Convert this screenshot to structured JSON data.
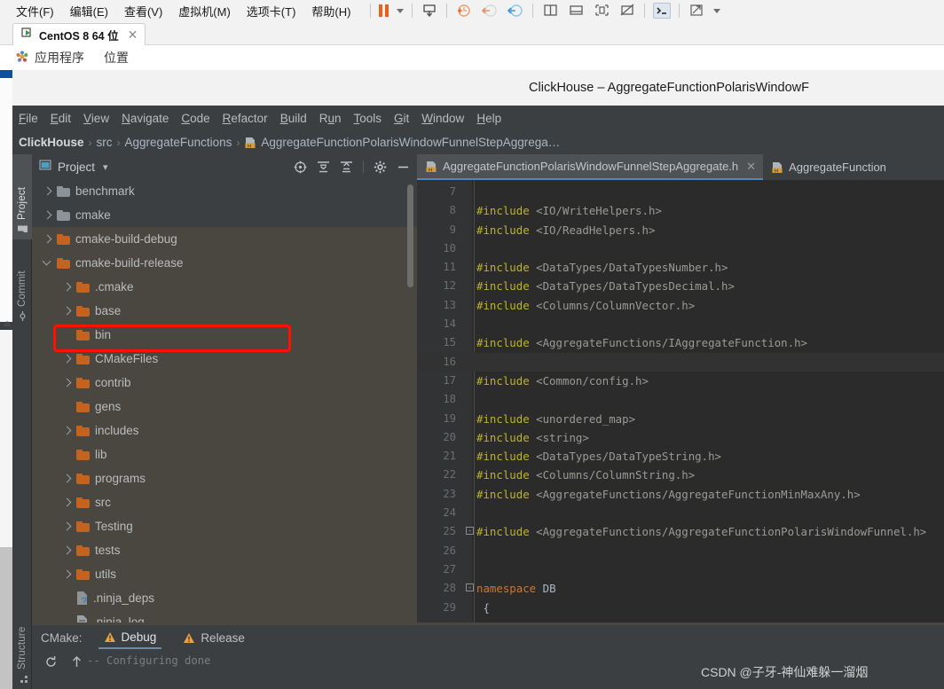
{
  "host": {
    "menu_items": [
      "文件(F)",
      "编辑(E)",
      "查看(V)",
      "虚拟机(M)",
      "选项卡(T)",
      "帮助(H)"
    ],
    "toolbar_icons": [
      "pause-icon",
      "dropdown-caret-icon",
      "send-ctrl-alt-del-icon",
      "snapshot-take-icon",
      "snapshot-revert-icon",
      "snapshot-manager-icon",
      "layout-sidebyside-icon",
      "layout-stacked-icon",
      "unity-mode-icon",
      "no-display-icon",
      "console-icon",
      "fullscreen-icon",
      "fullscreen-caret-icon"
    ],
    "tab": {
      "label": "CentOS 8 64 位",
      "close": "✕",
      "icon": "vm-running-icon"
    },
    "gnome": {
      "applications": "应用程序",
      "places": "位置",
      "icon": "gnome-foot-icon"
    }
  },
  "ide": {
    "title": "ClickHouse – AggregateFunctionPolarisWindowF",
    "menu": [
      {
        "pre": "",
        "mn": "F",
        "post": "ile"
      },
      {
        "pre": "",
        "mn": "E",
        "post": "dit"
      },
      {
        "pre": "",
        "mn": "V",
        "post": "iew"
      },
      {
        "pre": "",
        "mn": "N",
        "post": "avigate"
      },
      {
        "pre": "",
        "mn": "C",
        "post": "ode"
      },
      {
        "pre": "",
        "mn": "R",
        "post": "efactor"
      },
      {
        "pre": "",
        "mn": "B",
        "post": "uild"
      },
      {
        "pre": "R",
        "mn": "u",
        "post": "n"
      },
      {
        "pre": "",
        "mn": "T",
        "post": "ools"
      },
      {
        "pre": "",
        "mn": "G",
        "post": "it"
      },
      {
        "pre": "",
        "mn": "W",
        "post": "indow"
      },
      {
        "pre": "",
        "mn": "H",
        "post": "elp"
      }
    ],
    "breadcrumb": {
      "sep": "›",
      "items": [
        "ClickHouse",
        "src",
        "AggregateFunctions"
      ],
      "file": "AggregateFunctionPolarisWindowFunnelStepAggrega…",
      "file_icon": "header-file-icon"
    },
    "stripes": {
      "project": "Project",
      "commit": "Commit",
      "structure": "Structure"
    },
    "project_panel": {
      "title": "Project",
      "caret": "▾",
      "view_icon": "project-view-icon",
      "header_icons": [
        "scroll-from-source-icon",
        "expand-all-icon",
        "collapse-all-icon",
        "settings-gear-icon",
        "hide-panel-icon"
      ],
      "tree": [
        {
          "label": "benchmark",
          "indent": 0,
          "arrow": "right",
          "icon": "folder",
          "color": "#8d9499",
          "highlight": true
        },
        {
          "label": "cmake",
          "indent": 0,
          "arrow": "right",
          "icon": "folder",
          "color": "#8d9499",
          "highlight": true
        },
        {
          "label": "cmake-build-debug",
          "indent": 0,
          "arrow": "right",
          "icon": "folder",
          "color": "#c4631f",
          "highlight": false
        },
        {
          "label": "cmake-build-release",
          "indent": 0,
          "arrow": "down",
          "icon": "folder",
          "color": "#c4631f",
          "highlight": false,
          "annotated": true
        },
        {
          "label": ".cmake",
          "indent": 1,
          "arrow": "right",
          "icon": "folder",
          "color": "#c4631f",
          "highlight": false
        },
        {
          "label": "base",
          "indent": 1,
          "arrow": "right",
          "icon": "folder",
          "color": "#c4631f",
          "highlight": false
        },
        {
          "label": "bin",
          "indent": 1,
          "arrow": "none",
          "icon": "folder",
          "color": "#c4631f",
          "highlight": false
        },
        {
          "label": "CMakeFiles",
          "indent": 1,
          "arrow": "right",
          "icon": "folder",
          "color": "#c4631f",
          "highlight": false
        },
        {
          "label": "contrib",
          "indent": 1,
          "arrow": "right",
          "icon": "folder",
          "color": "#c4631f",
          "highlight": false
        },
        {
          "label": "gens",
          "indent": 1,
          "arrow": "none",
          "icon": "folder",
          "color": "#c4631f",
          "highlight": false
        },
        {
          "label": "includes",
          "indent": 1,
          "arrow": "right",
          "icon": "folder",
          "color": "#c4631f",
          "highlight": false
        },
        {
          "label": "lib",
          "indent": 1,
          "arrow": "none",
          "icon": "folder",
          "color": "#c4631f",
          "highlight": false
        },
        {
          "label": "programs",
          "indent": 1,
          "arrow": "right",
          "icon": "folder",
          "color": "#c4631f",
          "highlight": false
        },
        {
          "label": "src",
          "indent": 1,
          "arrow": "right",
          "icon": "folder",
          "color": "#c4631f",
          "highlight": false
        },
        {
          "label": "Testing",
          "indent": 1,
          "arrow": "right",
          "icon": "folder",
          "color": "#c4631f",
          "highlight": false
        },
        {
          "label": "tests",
          "indent": 1,
          "arrow": "right",
          "icon": "folder",
          "color": "#c4631f",
          "highlight": false
        },
        {
          "label": "utils",
          "indent": 1,
          "arrow": "right",
          "icon": "folder",
          "color": "#c4631f",
          "highlight": false
        },
        {
          "label": ".ninja_deps",
          "indent": 1,
          "arrow": "none",
          "icon": "unknown-file-icon",
          "color": "#9aa0a6",
          "highlight": false
        },
        {
          "label": ".ninja_log",
          "indent": 1,
          "arrow": "none",
          "icon": "text-file-icon",
          "color": "#9aa0a6",
          "highlight": false
        }
      ]
    },
    "editor": {
      "tabs": [
        {
          "label": "AggregateFunctionPolarisWindowFunnelStepAggregate.h",
          "active": true,
          "close": "✕",
          "icon": "header-file-icon"
        },
        {
          "label": "AggregateFunction",
          "active": false,
          "close": "",
          "icon": "header-file-icon"
        }
      ],
      "lines": [
        {
          "n": 7,
          "fold": "",
          "segs": []
        },
        {
          "n": 8,
          "fold": "",
          "segs": [
            {
              "t": "#include ",
              "c": "inc"
            },
            {
              "t": "<IO/WriteHelpers.h>",
              "c": "path"
            }
          ]
        },
        {
          "n": 9,
          "fold": "",
          "segs": [
            {
              "t": "#include ",
              "c": "inc"
            },
            {
              "t": "<IO/ReadHelpers.h>",
              "c": "path"
            }
          ]
        },
        {
          "n": 10,
          "fold": "",
          "segs": []
        },
        {
          "n": 11,
          "fold": "",
          "segs": [
            {
              "t": "#include ",
              "c": "inc"
            },
            {
              "t": "<DataTypes/DataTypesNumber.h>",
              "c": "path"
            }
          ]
        },
        {
          "n": 12,
          "fold": "",
          "segs": [
            {
              "t": "#include ",
              "c": "inc"
            },
            {
              "t": "<DataTypes/DataTypesDecimal.h>",
              "c": "path"
            }
          ]
        },
        {
          "n": 13,
          "fold": "",
          "segs": [
            {
              "t": "#include ",
              "c": "inc"
            },
            {
              "t": "<Columns/ColumnVector.h>",
              "c": "path"
            }
          ]
        },
        {
          "n": 14,
          "fold": "",
          "segs": []
        },
        {
          "n": 15,
          "fold": "",
          "segs": [
            {
              "t": "#include ",
              "c": "inc"
            },
            {
              "t": "<AggregateFunctions/IAggregateFunction.h>",
              "c": "path"
            }
          ]
        },
        {
          "n": 16,
          "fold": "",
          "segs": [],
          "current": true
        },
        {
          "n": 17,
          "fold": "",
          "segs": [
            {
              "t": "#include ",
              "c": "inc"
            },
            {
              "t": "<Common/config.h>",
              "c": "path"
            }
          ]
        },
        {
          "n": 18,
          "fold": "",
          "segs": []
        },
        {
          "n": 19,
          "fold": "",
          "segs": [
            {
              "t": "#include ",
              "c": "inc"
            },
            {
              "t": "<unordered_map>",
              "c": "path"
            }
          ]
        },
        {
          "n": 20,
          "fold": "",
          "segs": [
            {
              "t": "#include ",
              "c": "inc"
            },
            {
              "t": "<string>",
              "c": "path"
            }
          ]
        },
        {
          "n": 21,
          "fold": "",
          "segs": [
            {
              "t": "#include ",
              "c": "inc"
            },
            {
              "t": "<DataTypes/DataTypeString.h>",
              "c": "path"
            }
          ]
        },
        {
          "n": 22,
          "fold": "",
          "segs": [
            {
              "t": "#include ",
              "c": "inc"
            },
            {
              "t": "<Columns/ColumnString.h>",
              "c": "path"
            }
          ]
        },
        {
          "n": 23,
          "fold": "",
          "segs": [
            {
              "t": "#include ",
              "c": "inc"
            },
            {
              "t": "<AggregateFunctions/AggregateFunctionMinMaxAny.h>",
              "c": "path"
            }
          ]
        },
        {
          "n": 24,
          "fold": "",
          "segs": []
        },
        {
          "n": 25,
          "fold": "-",
          "segs": [
            {
              "t": "#include ",
              "c": "inc"
            },
            {
              "t": "<AggregateFunctions/AggregateFunctionPolarisWindowFunnel.h>",
              "c": "path"
            }
          ]
        },
        {
          "n": 26,
          "fold": "",
          "segs": []
        },
        {
          "n": 27,
          "fold": "",
          "segs": []
        },
        {
          "n": 28,
          "fold": "-",
          "segs": [
            {
              "t": "namespace ",
              "c": "kw"
            },
            {
              "t": "DB",
              "c": "id"
            }
          ]
        },
        {
          "n": 29,
          "fold": "",
          "segs": [
            {
              "t": " {",
              "c": "id"
            }
          ]
        }
      ]
    },
    "cmake": {
      "label": "CMake:",
      "tabs": [
        {
          "label": "Debug",
          "active": true,
          "icon": "warning-triangle-icon"
        },
        {
          "label": "Release",
          "active": false,
          "icon": "warning-triangle-icon"
        }
      ],
      "side_icons": [
        "rerun-cmake-icon",
        "scroll-up-icon"
      ],
      "log": "-- Configuring done"
    }
  },
  "watermark": "CSDN @子牙-神仙难躲一溜烟"
}
